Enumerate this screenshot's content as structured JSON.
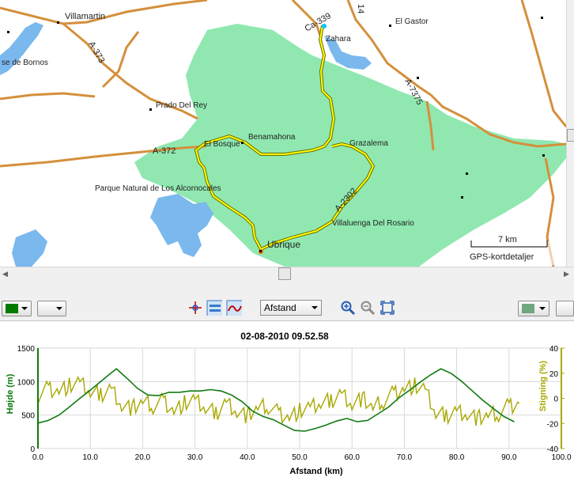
{
  "map": {
    "places": {
      "villamartin": "Villamartin",
      "el_gastor": "El Gastor",
      "zahara": "Zahara",
      "bornos": "se de Bornos",
      "prado_del_rey": "Prado Del Rey",
      "el_bosque": "El Bosque",
      "benamahona": "Benamahona",
      "grazalema": "Grazalema",
      "parque": "Parque Natural de Los Alcornocales",
      "villaluenga": "Villaluenga Del Rosario",
      "ubrique": "Ubrique"
    },
    "roads": {
      "a373": "A-373",
      "a372": "A-372",
      "a2302": "A-2302",
      "a7375": "A-7375",
      "ca339": "Ca-339",
      "n14": "14"
    },
    "scale_label": "7 km",
    "attribution": "GPS-kortdetaljer",
    "colors": {
      "park": "#90e8b0",
      "water": "#7ab8ee",
      "road": "#d4903c",
      "track": "#ffff00"
    }
  },
  "toolbar": {
    "track_color": "#007a00",
    "axis_select": "Afstand",
    "right_swatch_color": "#6fa77f"
  },
  "chart_data": {
    "type": "line",
    "title": "02-08-2010 09.52.58",
    "xlabel": "Afstand (km)",
    "ylabel": "Højde (m)",
    "y2label": "Stigning (%)",
    "xlim": [
      0,
      100
    ],
    "ylim": [
      0,
      1500
    ],
    "y2lim": [
      -40,
      40
    ],
    "x_ticks": [
      "0.0",
      "10.0",
      "20.0",
      "30.0",
      "40.0",
      "50.0",
      "60.0",
      "70.0",
      "80.0",
      "90.0",
      "100.0"
    ],
    "y_ticks": [
      "0",
      "500",
      "1000",
      "1500"
    ],
    "y2_ticks": [
      "-40",
      "-20",
      "0",
      "20",
      "40"
    ],
    "grid": true,
    "series": [
      {
        "color": "#0f7a0f",
        "x": [
          0,
          2,
          4,
          6,
          8,
          10,
          12,
          14,
          15,
          17,
          19,
          21,
          23,
          25,
          27,
          29,
          31,
          33,
          35,
          37,
          39,
          41,
          43,
          45,
          47,
          49,
          51,
          53,
          55,
          57,
          59,
          61,
          63,
          65,
          67,
          69,
          71,
          73,
          75,
          77,
          79,
          81,
          83,
          85,
          87,
          89,
          91
        ],
        "values": [
          380,
          420,
          500,
          620,
          750,
          870,
          1000,
          1130,
          1190,
          1050,
          900,
          800,
          790,
          840,
          840,
          860,
          860,
          880,
          860,
          800,
          700,
          560,
          480,
          430,
          350,
          270,
          260,
          300,
          350,
          410,
          450,
          400,
          420,
          520,
          620,
          760,
          870,
          990,
          1100,
          1190,
          1120,
          1000,
          860,
          720,
          600,
          480,
          400
        ]
      },
      {
        "color": "#a8a800",
        "x": [
          0,
          2,
          4,
          6,
          8,
          10,
          12,
          14,
          16,
          18,
          20,
          22,
          24,
          26,
          28,
          30,
          32,
          34,
          36,
          38,
          40,
          42,
          44,
          46,
          48,
          50,
          52,
          54,
          56,
          58,
          60,
          62,
          64,
          66,
          68,
          70,
          72,
          74,
          76,
          78,
          80,
          82,
          84,
          86,
          88,
          90,
          92
        ],
        "values": [
          2,
          8,
          6,
          10,
          12,
          5,
          3,
          8,
          -5,
          -8,
          -3,
          -6,
          -2,
          -10,
          -4,
          -2,
          -8,
          -12,
          -3,
          -10,
          -14,
          -8,
          -6,
          -12,
          -15,
          -10,
          -8,
          -4,
          -2,
          4,
          -4,
          0,
          -8,
          -2,
          4,
          8,
          10,
          6,
          -12,
          -14,
          -10,
          -12,
          -16,
          -14,
          -12,
          -6,
          -4
        ]
      }
    ]
  }
}
